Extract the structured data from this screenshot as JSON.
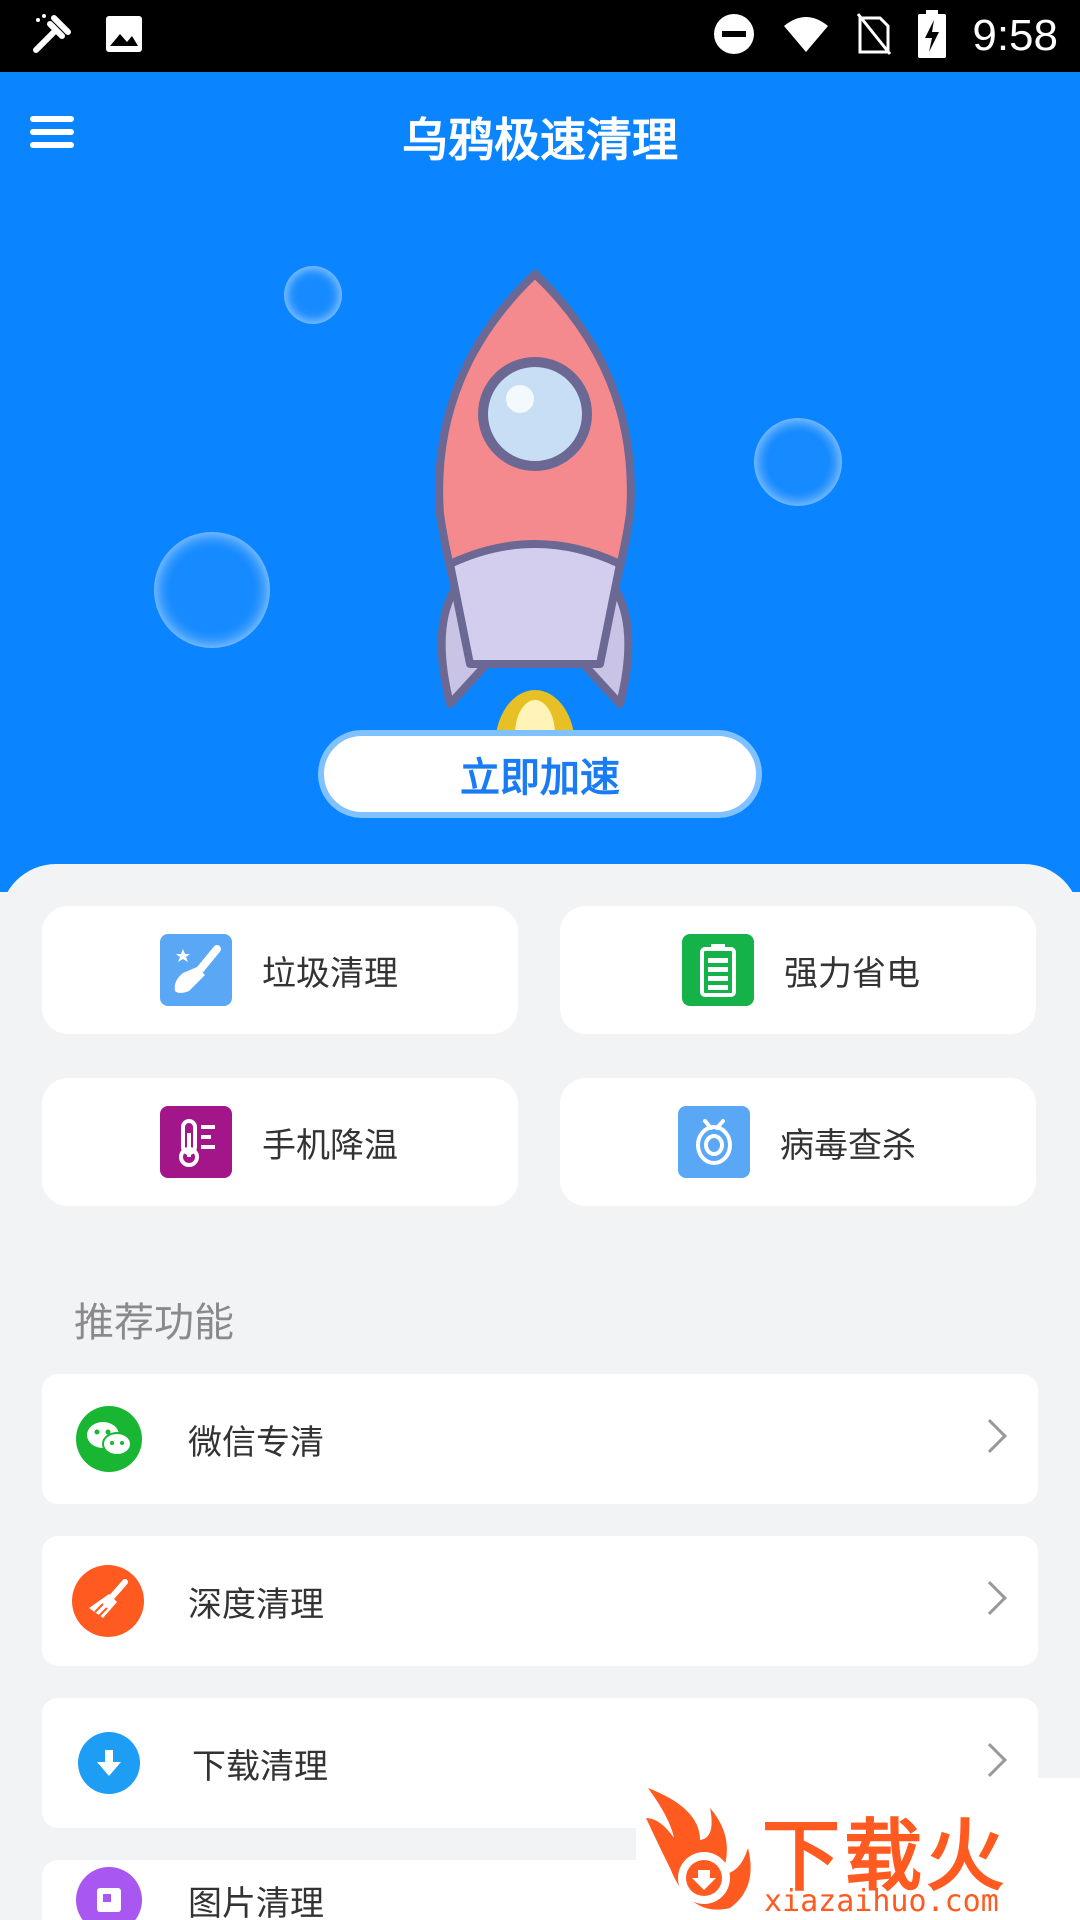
{
  "status_bar": {
    "time": "9:58",
    "left_icons": [
      "tool-icon",
      "image-icon"
    ],
    "right_icons": [
      "do-not-disturb-icon",
      "wifi-icon",
      "no-sim-icon",
      "battery-charging-icon"
    ]
  },
  "header": {
    "title": "乌鸦极速清理",
    "menu_icon": "hamburger-menu-icon"
  },
  "hero": {
    "boost_button": "立即加速",
    "illustration": "rocket-icon"
  },
  "tiles": [
    {
      "label": "垃圾清理",
      "icon": "brush-icon",
      "color": "#5aa8f5"
    },
    {
      "label": "强力省电",
      "icon": "battery-icon",
      "color": "#15b24a"
    },
    {
      "label": "手机降温",
      "icon": "thermometer-icon",
      "color": "#a3168a"
    },
    {
      "label": "病毒查杀",
      "icon": "bug-target-icon",
      "color": "#5aa8f5"
    }
  ],
  "recommend": {
    "title": "推荐功能",
    "items": [
      {
        "label": "微信专清",
        "icon": "wechat-icon",
        "color": "#19b634"
      },
      {
        "label": "深度清理",
        "icon": "broom-icon",
        "color": "#ff5a1f"
      },
      {
        "label": "下载清理",
        "icon": "download-icon",
        "color": "#1e9df5"
      },
      {
        "label": "图片清理",
        "icon": "picture-icon",
        "color": "#a857f0"
      }
    ]
  },
  "watermark": {
    "brand": "下载火",
    "url": "xiazaihuo.com"
  },
  "colors": {
    "primary_blue": "#0a84ff",
    "button_text": "#1a7cf5",
    "background": "#f2f3f5"
  }
}
